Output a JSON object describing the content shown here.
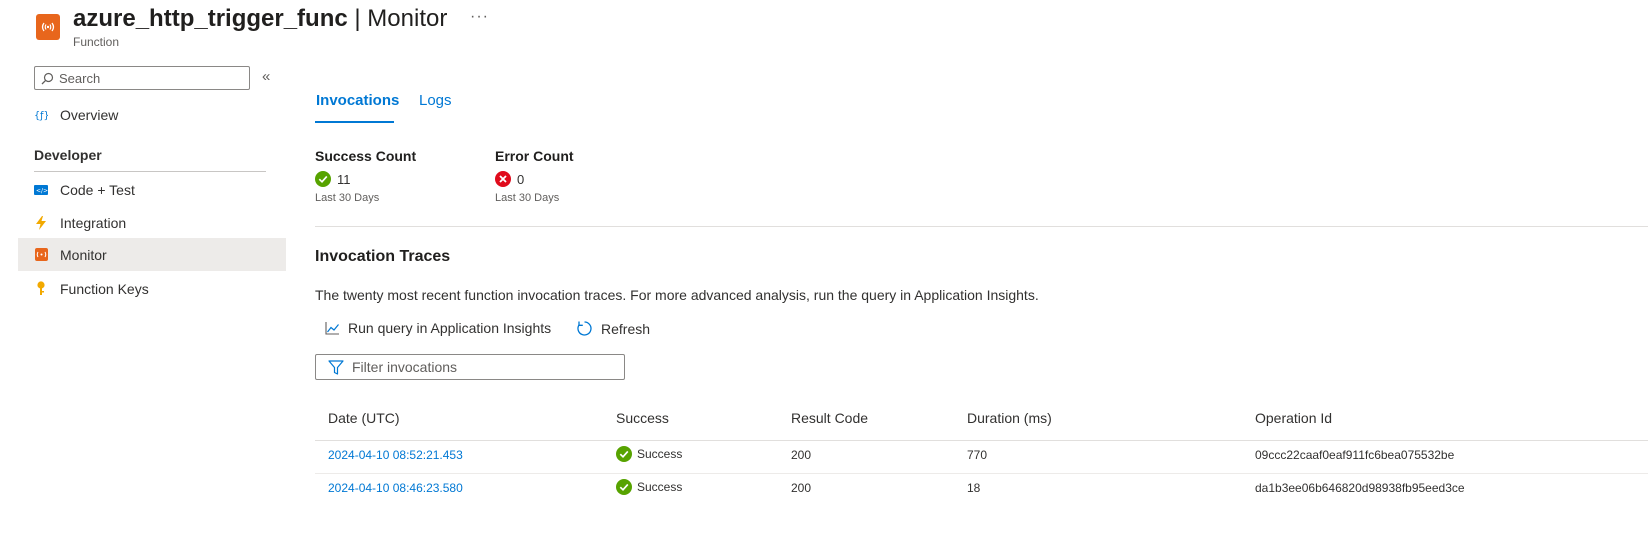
{
  "header": {
    "resource_name": "azure_http_trigger_func",
    "separator": " | ",
    "blade_name": "Monitor",
    "more": "···",
    "subtitle": "Function"
  },
  "sidebar": {
    "search_placeholder": "Search",
    "collapse": "«",
    "items": [
      {
        "label": "Overview",
        "icon": "function-icon"
      },
      {
        "label": "Code + Test",
        "icon": "code-icon"
      },
      {
        "label": "Integration",
        "icon": "lightning-icon"
      },
      {
        "label": "Monitor",
        "icon": "monitor-icon"
      },
      {
        "label": "Function Keys",
        "icon": "key-icon"
      }
    ],
    "section": "Developer"
  },
  "tabs": [
    {
      "label": "Invocations",
      "active": true
    },
    {
      "label": "Logs",
      "active": false
    }
  ],
  "counts": {
    "success": {
      "title": "Success Count",
      "value": "11",
      "period": "Last 30 Days"
    },
    "error": {
      "title": "Error Count",
      "value": "0",
      "period": "Last 30 Days"
    }
  },
  "traces": {
    "title": "Invocation Traces",
    "description": "The twenty most recent function invocation traces. For more advanced analysis, run the query in Application Insights.",
    "run_query_label": "Run query in Application Insights",
    "refresh_label": "Refresh",
    "filter_placeholder": "Filter invocations",
    "columns": [
      "Date (UTC)",
      "Success",
      "Result Code",
      "Duration (ms)",
      "Operation Id"
    ],
    "rows": [
      {
        "date": "2024-04-10 08:52:21.453",
        "success": "Success",
        "code": "200",
        "duration": "770",
        "op_id": "09ccc22caaf0eaf911fc6bea075532be"
      },
      {
        "date": "2024-04-10 08:46:23.580",
        "success": "Success",
        "code": "200",
        "duration": "18",
        "op_id": "da1b3ee06b646820d98938fb95eed3ce"
      }
    ]
  },
  "colors": {
    "accent": "#0078d4",
    "success": "#57a300",
    "error": "#e00b1c",
    "function_orange": "#e8661c"
  }
}
